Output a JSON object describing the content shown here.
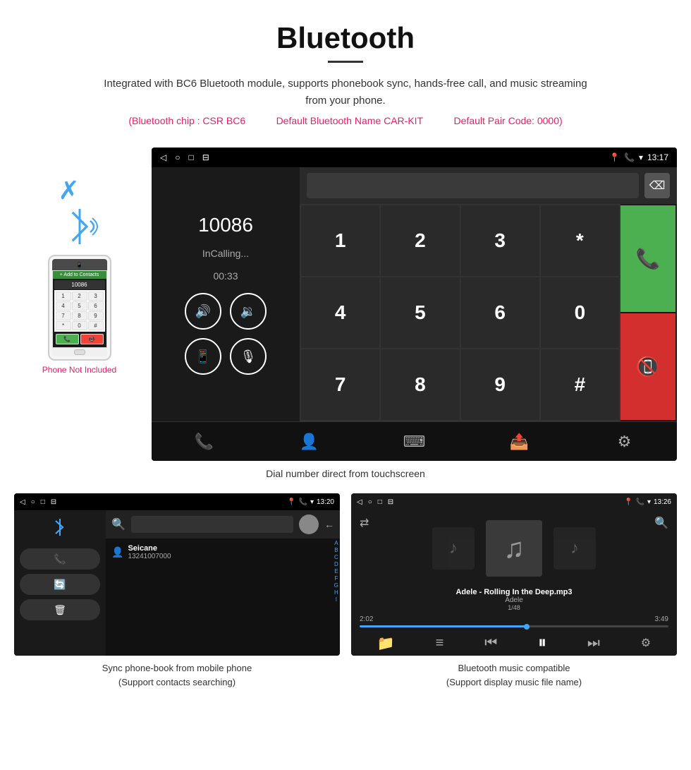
{
  "header": {
    "title": "Bluetooth",
    "description": "Integrated with BC6 Bluetooth module, supports phonebook sync, hands-free call, and music streaming from your phone.",
    "specs": {
      "chip": "(Bluetooth chip : CSR BC6",
      "name": "Default Bluetooth Name CAR-KIT",
      "code": "Default Pair Code: 0000)"
    }
  },
  "car_screen": {
    "status_bar": {
      "left_icons": [
        "◁",
        "○",
        "□",
        "⊟"
      ],
      "right_icons": [
        "📍",
        "📞",
        "▾",
        "13:17"
      ]
    },
    "dial": {
      "number": "10086",
      "status": "InCalling...",
      "timer": "00:33"
    },
    "numpad": [
      "1",
      "2",
      "3",
      "*",
      "4",
      "5",
      "6",
      "0",
      "7",
      "8",
      "9",
      "#"
    ],
    "caption": "Dial number direct from touchscreen"
  },
  "phonebook_screen": {
    "status_bar": {
      "left_icons": [
        "◁",
        "○",
        "□",
        "⊟"
      ],
      "right": "13:20"
    },
    "contact": {
      "name": "Seicane",
      "number": "13241007000"
    },
    "alphabet": [
      "A",
      "B",
      "C",
      "D",
      "E",
      "F",
      "G",
      "H",
      "I"
    ],
    "caption": "Sync phone-book from mobile phone\n(Support contacts searching)"
  },
  "music_screen": {
    "status_bar": {
      "left_icons": [
        "◁",
        "○",
        "□",
        "⊟"
      ],
      "right": "13:26"
    },
    "track": {
      "name": "Adele - Rolling In the Deep.mp3",
      "artist": "Adele",
      "position": "1/48",
      "current_time": "2:02",
      "total_time": "3:49"
    },
    "caption": "Bluetooth music compatible\n(Support display music file name)"
  },
  "phone_mockup": {
    "not_included": "Phone Not Included",
    "add_contacts": "+ Add to Contacts"
  }
}
